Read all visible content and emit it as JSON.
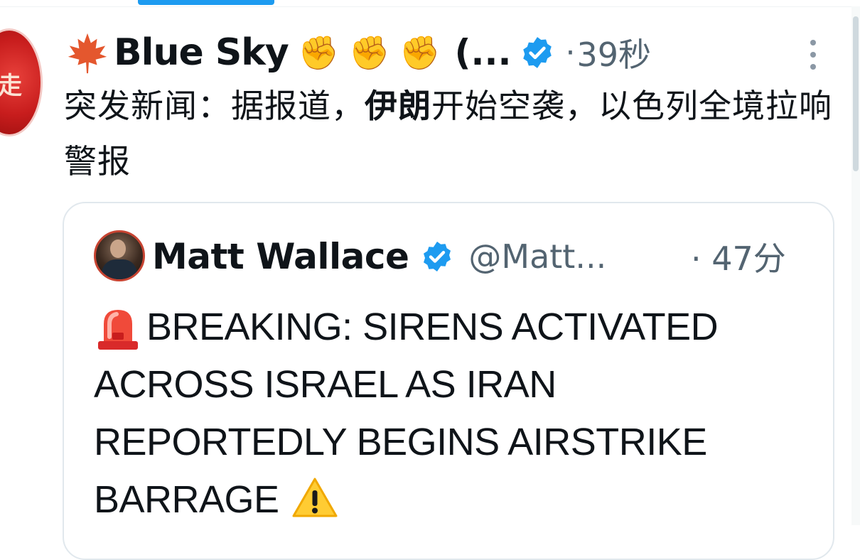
{
  "post": {
    "display_name": "Blue Sky",
    "name_truncated": "(...",
    "time_dot": "·",
    "time": "39秒",
    "text_part1": "突发新闻：据报道，",
    "text_bold": "伊朗",
    "text_part2": "开始空袭，以色列全境拉响警报",
    "icons": [
      "maple-leaf-icon",
      "raised-fist-icon",
      "raised-fist-icon",
      "raised-fist-icon",
      "verified-badge-icon",
      "more-options-icon"
    ]
  },
  "quote": {
    "display_name": "Matt Wallace",
    "handle": "@Matt...",
    "time": "· 47分",
    "text": "BREAKING: SIRENS ACTIVATED ACROSS ISRAEL AS IRAN REPORTEDLY BEGINS AIRSTRIKE BARRAGE",
    "icons": [
      "siren-icon",
      "verified-badge-icon",
      "warning-icon"
    ]
  },
  "colors": {
    "accent": "#1d9bf0",
    "text": "#0f1419",
    "secondary_text": "#536471",
    "card_border": "#e1e8ed"
  }
}
